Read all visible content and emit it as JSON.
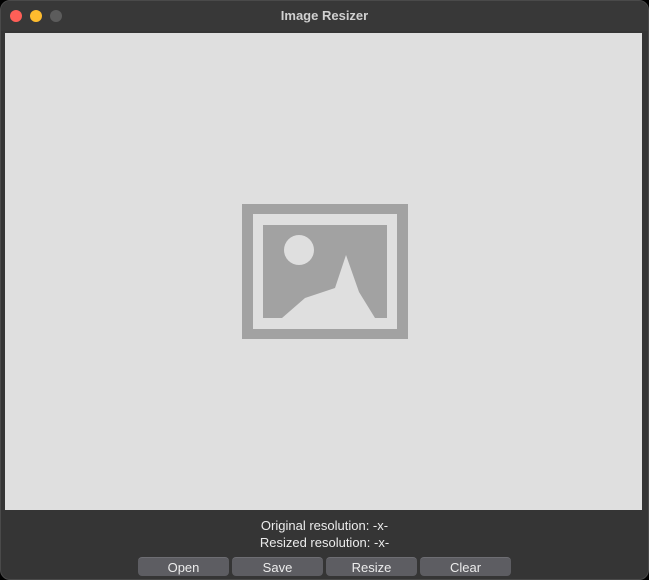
{
  "window": {
    "title": "Image Resizer"
  },
  "preview": {
    "placeholder_icon": "image-placeholder-icon"
  },
  "info": {
    "original_resolution": "Original resolution: -x-",
    "resized_resolution": "Resized resolution: -x-"
  },
  "buttons": {
    "open": "Open",
    "save": "Save",
    "resize": "Resize",
    "clear": "Clear"
  },
  "colors": {
    "close": "#ff5f57",
    "minimize": "#febc2e",
    "maximize_disabled": "#5c5c5c",
    "canvas_background": "#dfdfdf",
    "placeholder_gray": "#a2a2a2",
    "button_background": "#5d5d62"
  }
}
